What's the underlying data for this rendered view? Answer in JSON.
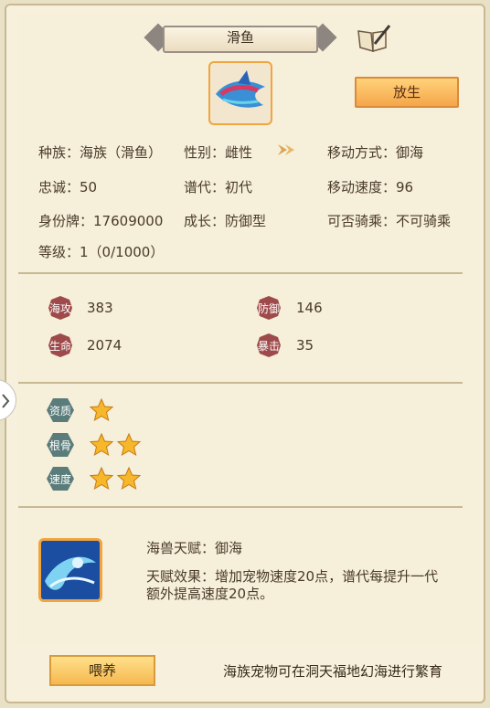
{
  "header": {
    "title": "滑鱼"
  },
  "actions": {
    "release_label": "放生",
    "feed_label": "喂养"
  },
  "info": {
    "race_label": "种族：",
    "race_value": "海族（滑鱼）",
    "gender_label": "性别：",
    "gender_value": "雌性",
    "move_mode_label": "移动方式：",
    "move_mode_value": "御海",
    "loyalty_label": "忠诚：",
    "loyalty_value": "50",
    "generation_label": "谱代：",
    "generation_value": "初代",
    "move_speed_label": "移动速度：",
    "move_speed_value": "96",
    "id_label": "身份牌：",
    "id_value": "17609000",
    "growth_label": "成长：",
    "growth_value": "防御型",
    "ride_label": "可否骑乘：",
    "ride_value": "不可骑乘",
    "level_label": "等级：",
    "level_value": "1（0/1000）"
  },
  "stats": {
    "attack_label": "海攻",
    "attack_value": "383",
    "defense_label": "防御",
    "defense_value": "146",
    "hp_label": "生命",
    "hp_value": "2074",
    "crit_label": "暴击",
    "crit_value": "35"
  },
  "aptitude": {
    "quality_label": "资质",
    "quality_stars": 1,
    "bone_label": "根骨",
    "bone_stars": 2,
    "speed_label": "速度",
    "speed_stars": 2
  },
  "skill": {
    "title": "海兽天赋：御海",
    "desc": "天赋效果：增加宠物速度20点，谱代每提升一代额外提高速度20点。"
  },
  "footer": {
    "tip": "海族宠物可在洞天福地幻海进行繁育"
  },
  "colors": {
    "accent": "#f5a64a",
    "badge": "#9e4a4a",
    "badge_teal": "#5a7c7a",
    "star": "#f6b72a"
  }
}
